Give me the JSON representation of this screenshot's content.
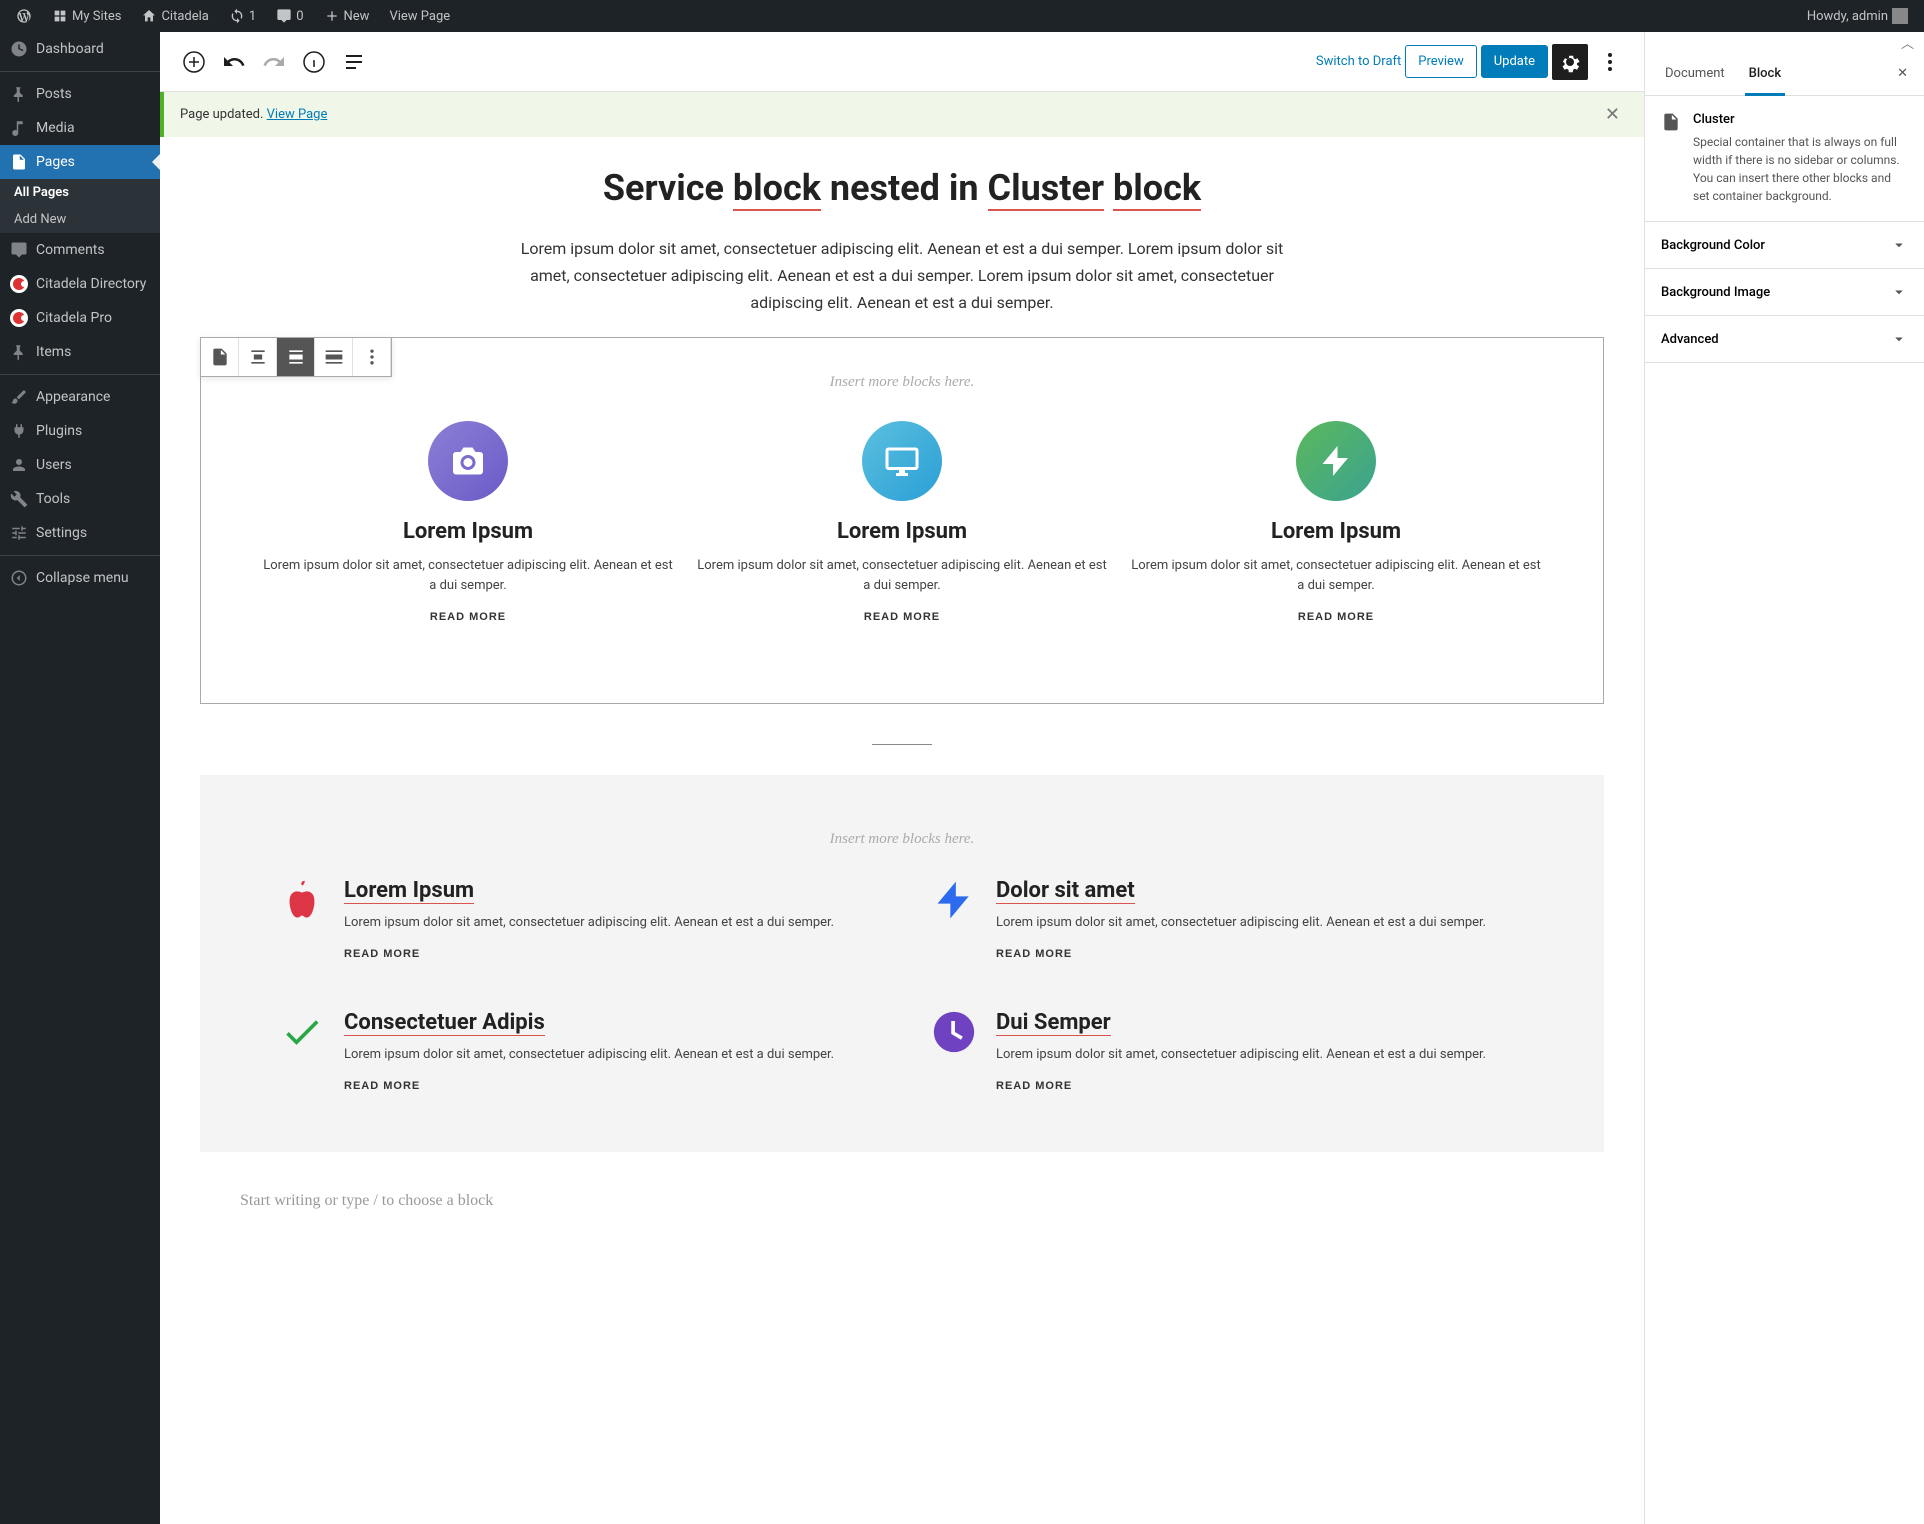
{
  "adminbar": {
    "my_sites": "My Sites",
    "site_name": "Citadela",
    "updates": "1",
    "comments": "0",
    "new": "New",
    "view_page": "View Page",
    "howdy": "Howdy, admin"
  },
  "sidebar": {
    "dashboard": "Dashboard",
    "posts": "Posts",
    "media": "Media",
    "pages": "Pages",
    "all_pages": "All Pages",
    "add_new": "Add New",
    "comments": "Comments",
    "citadela_dir": "Citadela Directory",
    "citadela_pro": "Citadela Pro",
    "items": "Items",
    "appearance": "Appearance",
    "plugins": "Plugins",
    "users": "Users",
    "tools": "Tools",
    "settings": "Settings",
    "collapse": "Collapse menu"
  },
  "toolbar": {
    "switch_draft": "Switch to Draft",
    "preview": "Preview",
    "update": "Update"
  },
  "notice": {
    "text": "Page updated.",
    "link": "View Page"
  },
  "page": {
    "title_parts": [
      "Service ",
      "block",
      " nested",
      " in ",
      "Cluster",
      " ",
      "block"
    ],
    "intro": "Lorem ipsum dolor sit amet, consectetuer adipiscing elit. Aenean et est a dui semper. Lorem ipsum dolor sit amet, consectetuer adipiscing elit. Aenean et est a dui semper.   Lorem ipsum dolor sit amet, consectetuer adipiscing elit. Aenean et est a dui semper.",
    "insert_hint": "Insert more blocks here.",
    "read_more": "READ MORE",
    "placeholder": "Start writing or type / to choose a block",
    "services": [
      {
        "title": "Lorem Ipsum",
        "desc": "Lorem ipsum dolor sit amet, consectetuer adipiscing elit. Aenean et est a dui semper."
      },
      {
        "title": "Lorem Ipsum",
        "desc": "Lorem ipsum dolor sit amet, consectetuer adipiscing elit. Aenean et est a dui semper."
      },
      {
        "title": "Lorem Ipsum",
        "desc": "Lorem ipsum dolor sit amet, consectetuer adipiscing elit. Aenean et est a dui semper."
      }
    ],
    "services2": [
      {
        "title": "Lorem Ipsum",
        "desc": "Lorem ipsum dolor sit amet, consectetuer adipiscing elit. Aenean et est a dui semper."
      },
      {
        "title": "Dolor sit amet",
        "desc": "Lorem ipsum dolor sit amet, consectetuer adipiscing elit. Aenean et est a dui semper."
      },
      {
        "title": "Consectetuer Adipis",
        "desc": "Lorem ipsum dolor sit amet, consectetuer adipiscing elit. Aenean et est a dui semper."
      },
      {
        "title": "Dui Semper",
        "desc": "Lorem ipsum dolor sit amet, consectetuer adipiscing elit. Aenean et est a dui semper."
      }
    ]
  },
  "settings": {
    "tab_document": "Document",
    "tab_block": "Block",
    "block_name": "Cluster",
    "block_desc": "Special container that is always on full width if there is no sidebar or columns. You can insert there other blocks and set container background.",
    "sections": [
      "Background Color",
      "Background Image",
      "Advanced"
    ]
  }
}
